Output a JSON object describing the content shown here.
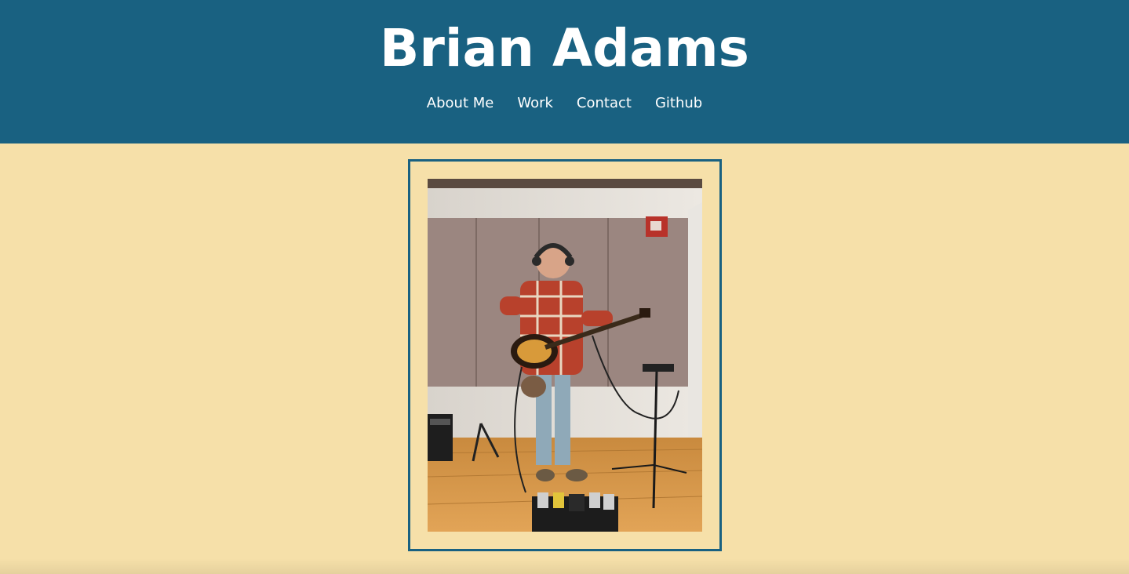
{
  "header": {
    "title": "Brian Adams",
    "nav": [
      {
        "label": "About Me"
      },
      {
        "label": "Work"
      },
      {
        "label": "Contact"
      },
      {
        "label": "Github"
      }
    ]
  },
  "main": {
    "photo": {
      "subject": "profile-photo"
    }
  },
  "colors": {
    "header_bg": "#196181",
    "page_bg": "#f6e0a9",
    "text": "#ffffff"
  }
}
